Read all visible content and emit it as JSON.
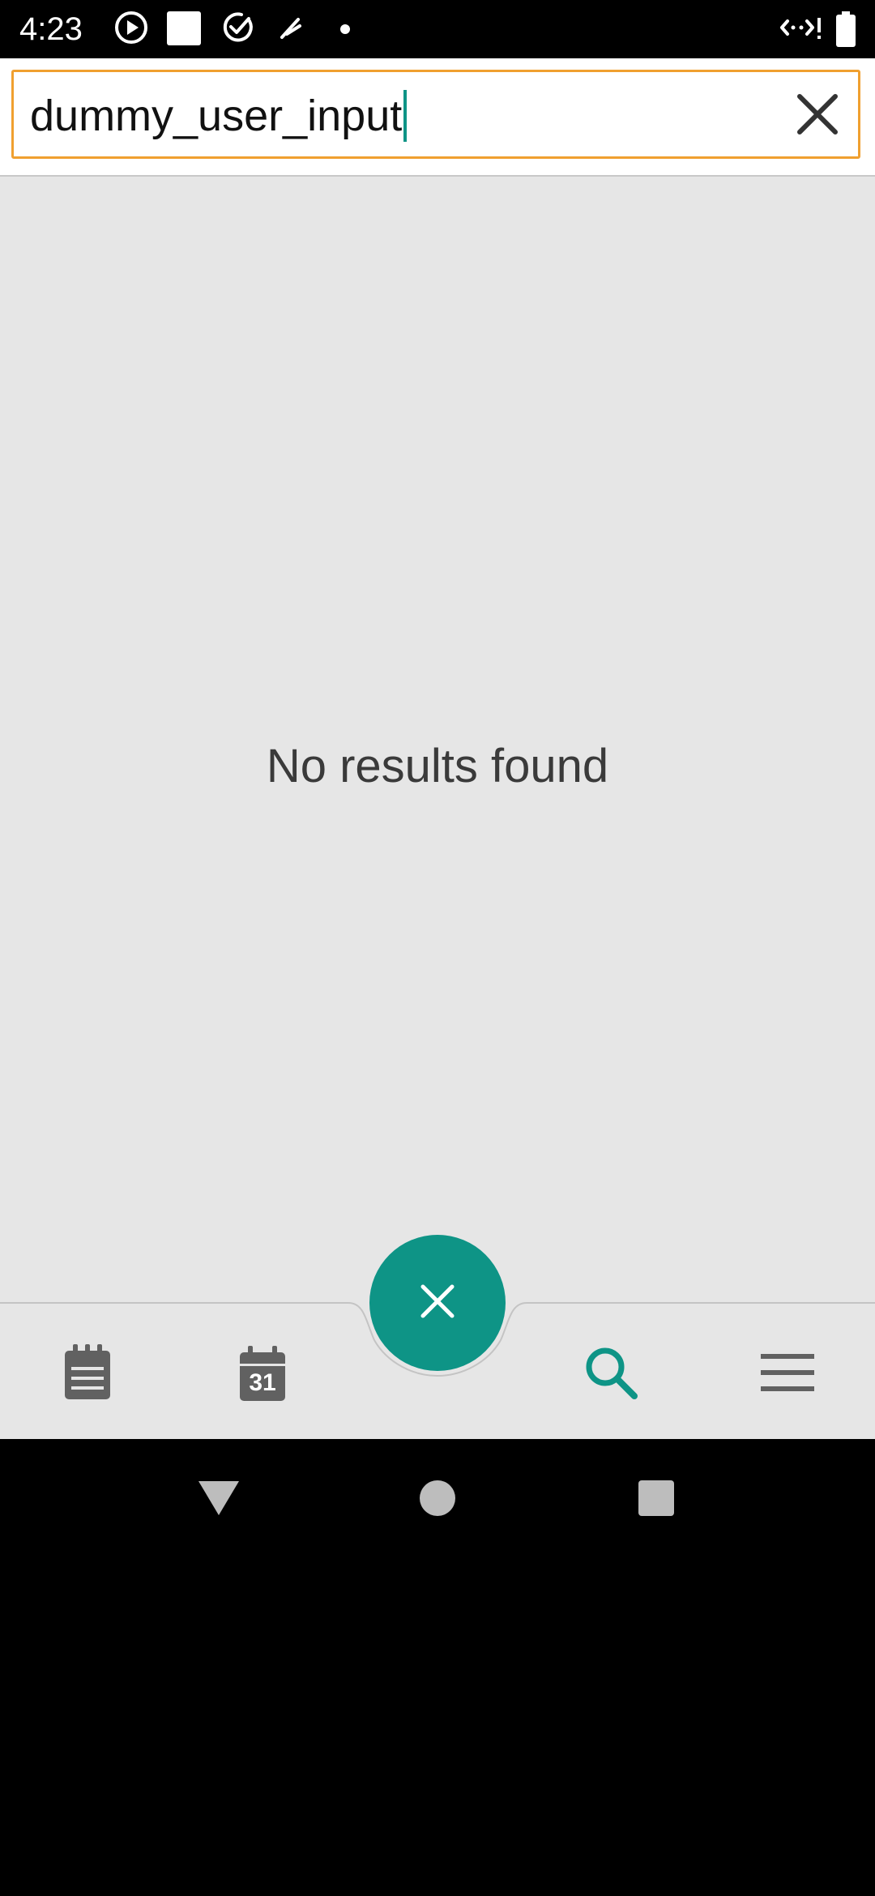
{
  "status_bar": {
    "time": "4:23",
    "icons": [
      "play-circle-icon",
      "square-icon",
      "check-circle-icon",
      "feather-icon",
      "dot-icon",
      "signal-icon",
      "battery-icon"
    ]
  },
  "search": {
    "value": "dummy_user_input",
    "clear_icon": "close-icon"
  },
  "results": {
    "empty_message": "No results found"
  },
  "bottom_nav": {
    "items": [
      {
        "icon": "notes-icon"
      },
      {
        "icon": "calendar-icon",
        "day": "31"
      },
      {
        "icon": "search-icon",
        "active": true
      },
      {
        "icon": "menu-icon"
      }
    ],
    "fab_icon": "close-icon"
  },
  "colors": {
    "accent": "#0e9486",
    "search_border": "#f0a030",
    "background": "#e6e6e6",
    "icon_gray": "#616161"
  }
}
